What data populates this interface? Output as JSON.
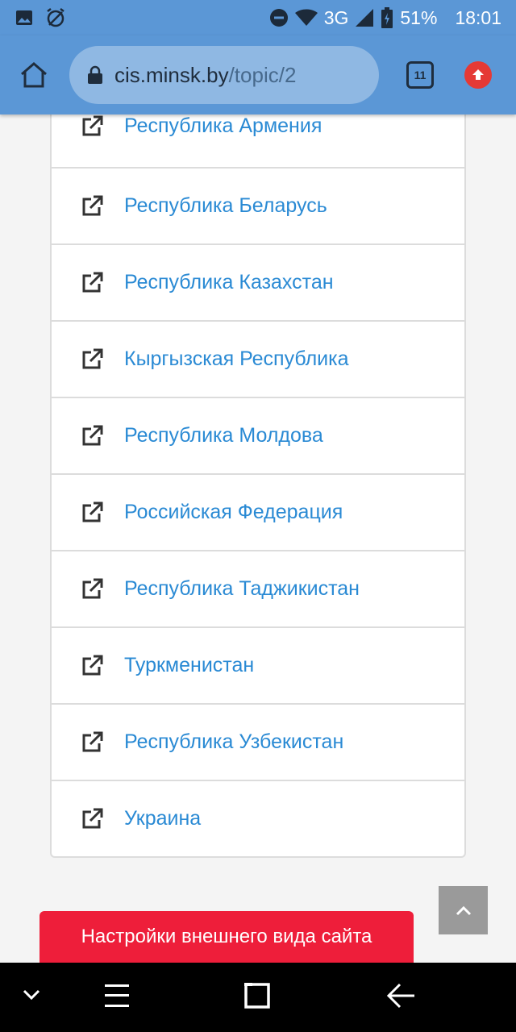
{
  "status_bar": {
    "network": "3G",
    "battery": "51%",
    "time": "18:01",
    "icons": [
      "image-icon",
      "no-alarm-icon",
      "do-not-disturb-icon",
      "wifi-icon",
      "signal-icon",
      "battery-icon"
    ]
  },
  "browser": {
    "url_host": "cis.minsk.by",
    "url_path": "/topic/2",
    "tab_count": "11"
  },
  "countries": [
    {
      "label": "Республика Армения"
    },
    {
      "label": "Республика Беларусь"
    },
    {
      "label": "Республика Казахстан"
    },
    {
      "label": "Кыргызская Республика"
    },
    {
      "label": "Республика Молдова"
    },
    {
      "label": "Российская Федерация"
    },
    {
      "label": "Республика Таджикистан"
    },
    {
      "label": "Туркменистан"
    },
    {
      "label": "Республика Узбекистан"
    },
    {
      "label": "Украина"
    }
  ],
  "settings_button": "Настройки внешнего вида сайта",
  "colors": {
    "accent": "#5b97d6",
    "link": "#2a8ad4",
    "banner": "#ee1e3a"
  }
}
